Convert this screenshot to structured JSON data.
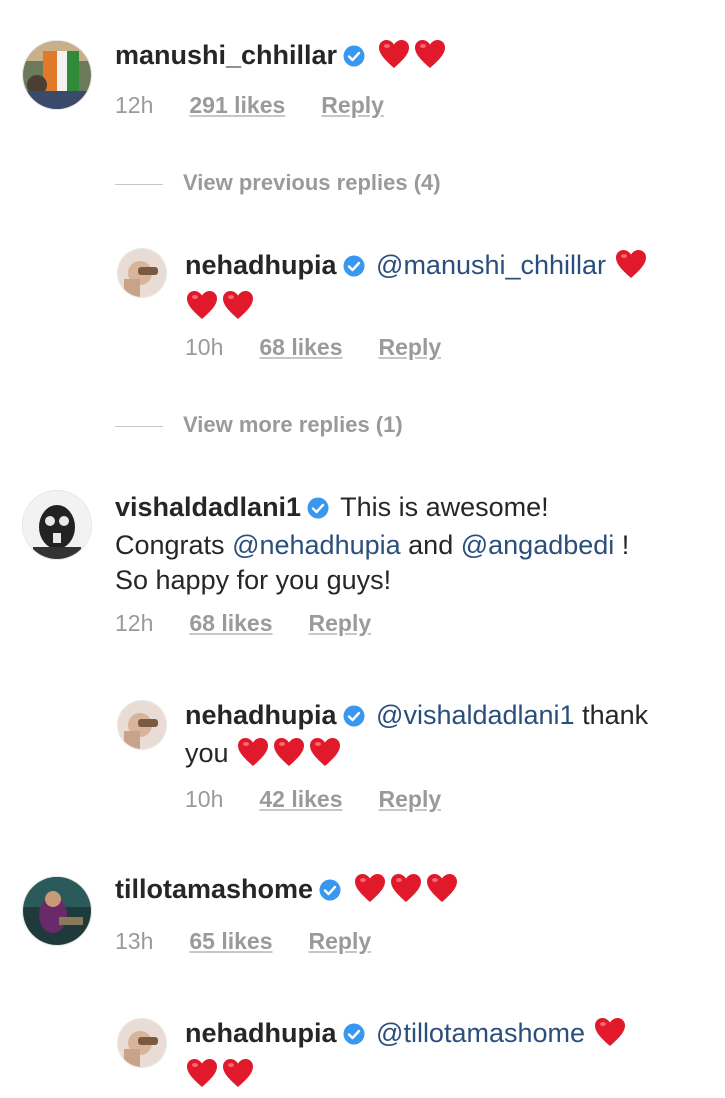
{
  "comments": [
    {
      "username": "manushi_chhillar",
      "text": "",
      "hearts": 2,
      "time": "12h",
      "likes": "291 likes",
      "reply": "Reply",
      "thread_link": "View previous replies (4)",
      "replies": [
        {
          "username": "nehadhupia",
          "mention": "@manushi_chhillar",
          "text": "",
          "time": "10h",
          "likes": "68 likes",
          "reply": "Reply"
        }
      ],
      "more_link": "View more replies (1)"
    },
    {
      "username": "vishaldadlani1",
      "text_line1": "This is awesome!",
      "text_line2_pre": "Congrats",
      "mention1": "@nehadhupia",
      "and": "and",
      "mention2": "@angadbedi",
      "bang": "!",
      "text_line3": "So happy for you guys!",
      "time": "12h",
      "likes": "68 likes",
      "reply": "Reply",
      "replies": [
        {
          "username": "nehadhupia",
          "mention": "@vishaldadlani1",
          "text": "thank",
          "text2": "you",
          "time": "10h",
          "likes": "42 likes",
          "reply": "Reply"
        }
      ]
    },
    {
      "username": "tillotamashome",
      "time": "13h",
      "likes": "65 likes",
      "reply": "Reply",
      "replies": [
        {
          "username": "nehadhupia",
          "mention": "@tillotamashome"
        }
      ]
    }
  ],
  "icons": {
    "verified": "verified-badge-icon",
    "heart": "red-heart-emoji"
  },
  "colors": {
    "verified": "#3897f0",
    "mention": "#2b4f7c",
    "heart": "#e0192b",
    "meta": "#9a9a9a"
  }
}
